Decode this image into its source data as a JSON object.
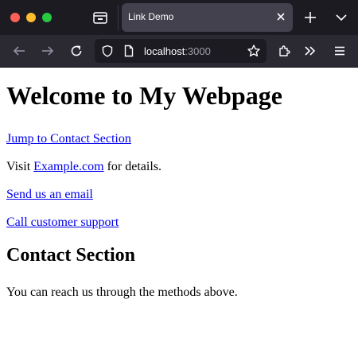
{
  "browser": {
    "tab_title": "Link Demo",
    "url_host": "localhost",
    "url_port": ":3000"
  },
  "page": {
    "heading": "Welcome to My Webpage",
    "jump_link": "Jump to Contact Section",
    "visit_prefix": "Visit ",
    "example_link": "Example.com",
    "visit_suffix": " for details.",
    "email_link": "Send us an email",
    "phone_link": "Call customer support",
    "contact_heading": "Contact Section",
    "contact_text": "You can reach us through the methods above."
  },
  "colors": {
    "link": "#0000ee",
    "chrome_dark": "#1c1b22",
    "toolbar": "#2b2a33",
    "active_tab": "#42414d"
  }
}
